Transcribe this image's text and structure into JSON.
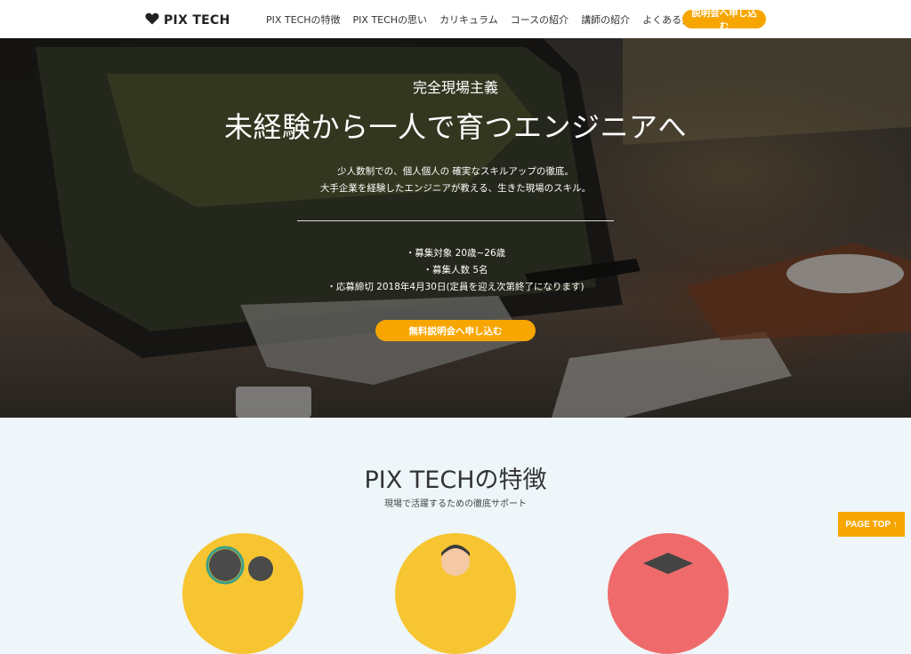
{
  "header": {
    "logo_text": "PIX TECH",
    "nav": [
      "PIX TECHの特徴",
      "PIX TECHの思い",
      "カリキュラム",
      "コースの紹介",
      "講師の紹介",
      "よくある質問"
    ],
    "cta_label": "説明会へ申し込む"
  },
  "hero": {
    "tagline": "完全現場主義",
    "title": "未経験から一人で育つエンジニアへ",
    "desc_line1": "少人数制での、個人個人の 確実なスキルアップの徹底。",
    "desc_line2": "大手企業を経験したエンジニアが教える、生きた現場のスキル。",
    "req1": "・募集対象 20歳~26歳",
    "req2": "・募集人数 5名",
    "req3": "・応募締切 2018年4月30日(定員を迎え次第終了になります)",
    "cta_label": "無料説明会へ申し込む"
  },
  "features": {
    "title": "PIX TECHの特徴",
    "subtitle": "現場で活躍するための徹底サポート"
  },
  "page_top_label": "PAGE TOP ↑",
  "colors": {
    "accent": "#f7a600",
    "circle_yellow": "#f7c531",
    "circle_red": "#ef6b6b"
  }
}
